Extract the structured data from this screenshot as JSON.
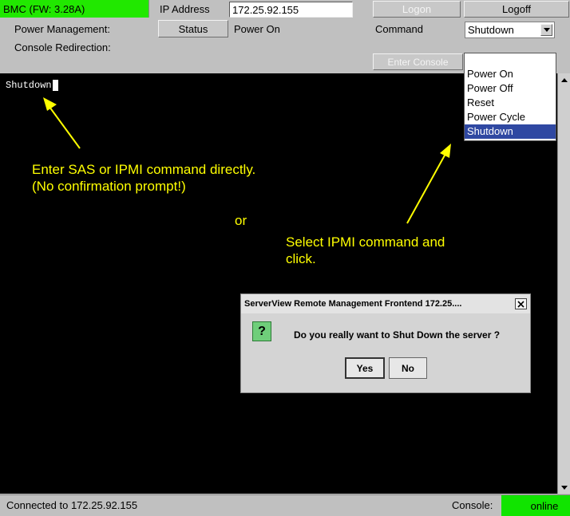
{
  "header": {
    "bmc_label": "BMC (FW: 3.28A)",
    "ip_label": "IP Address",
    "ip_value": "172.25.92.155",
    "logon_label": "Logon",
    "logoff_label": "Logoff"
  },
  "power_row": {
    "label": "Power Management:",
    "status_button": "Status",
    "state": "Power On",
    "command_label": "Command",
    "command_selected": "Shutdown"
  },
  "console_row": {
    "label": "Console Redirection:",
    "enter_console_label": "Enter Console"
  },
  "dropdown": {
    "options": [
      "Power On",
      "Power Off",
      "Reset",
      "Power Cycle",
      "Shutdown"
    ],
    "selected_index": 4
  },
  "terminal": {
    "typed_text": "Shutdown"
  },
  "annotations": {
    "direct": "Enter SAS or IPMI command directly.\n(No confirmation prompt!)",
    "or": "or",
    "select": "Select IPMI command and\nclick."
  },
  "dialog": {
    "title": "ServerView Remote Management Frontend 172.25....",
    "message": "Do you really want to Shut Down the server ?",
    "yes_label": "Yes",
    "no_label": "No",
    "icon_glyph": "?"
  },
  "status_bar": {
    "connection": "Connected to 172.25.92.155",
    "console_label": "Console:",
    "console_state": "online"
  },
  "colors": {
    "bmc_badge": "#21e800",
    "online_badge": "#11e400",
    "annotation": "#ffff00",
    "selection": "#2f48a2"
  }
}
